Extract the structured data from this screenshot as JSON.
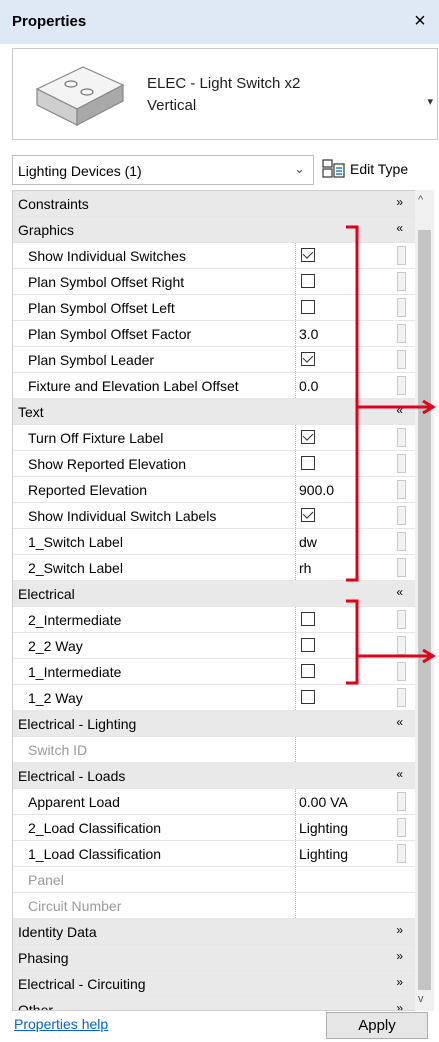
{
  "window": {
    "title": "Properties",
    "close_glyph": "×"
  },
  "type_selector": {
    "line1": "ELEC - Light Switch x2",
    "line2": "Vertical",
    "dropdown_glyph": "▾"
  },
  "instance_filter": {
    "value": "Lighting Devices (1)",
    "chevron": "⌄"
  },
  "edit_type": {
    "label": "Edit Type",
    "icon": "edit-type-icon"
  },
  "rows": [
    {
      "kind": "cat",
      "label": "Constraints",
      "toggle": "expand"
    },
    {
      "kind": "cat",
      "label": "Graphics",
      "toggle": "collapse"
    },
    {
      "kind": "prop",
      "label": "Show Individual Switches",
      "type": "check",
      "checked": true
    },
    {
      "kind": "prop",
      "label": "Plan Symbol Offset Right",
      "type": "check",
      "checked": false
    },
    {
      "kind": "prop",
      "label": "Plan Symbol Offset Left",
      "type": "check",
      "checked": false
    },
    {
      "kind": "prop",
      "label": "Plan Symbol Offset Factor",
      "type": "text",
      "value": "3.0"
    },
    {
      "kind": "prop",
      "label": "Plan Symbol Leader",
      "type": "check",
      "checked": true
    },
    {
      "kind": "prop",
      "label": "Fixture and Elevation Label Offset",
      "type": "text",
      "value": "0.0"
    },
    {
      "kind": "cat",
      "label": "Text",
      "toggle": "collapse"
    },
    {
      "kind": "prop",
      "label": "Turn Off Fixture Label",
      "type": "check",
      "checked": true
    },
    {
      "kind": "prop",
      "label": "Show Reported Elevation",
      "type": "check",
      "checked": false
    },
    {
      "kind": "prop",
      "label": "Reported Elevation",
      "type": "text",
      "value": "900.0"
    },
    {
      "kind": "prop",
      "label": "Show Individual Switch Labels",
      "type": "check",
      "checked": true
    },
    {
      "kind": "prop",
      "label": "1_Switch Label",
      "type": "text",
      "value": "dw"
    },
    {
      "kind": "prop",
      "label": "2_Switch Label",
      "type": "text",
      "value": "rh"
    },
    {
      "kind": "cat",
      "label": "Electrical",
      "toggle": "collapse"
    },
    {
      "kind": "prop",
      "label": "2_Intermediate",
      "type": "check",
      "checked": false
    },
    {
      "kind": "prop",
      "label": "2_2 Way",
      "type": "check",
      "checked": false
    },
    {
      "kind": "prop",
      "label": "1_Intermediate",
      "type": "check",
      "checked": false
    },
    {
      "kind": "prop",
      "label": "1_2 Way",
      "type": "check",
      "checked": false
    },
    {
      "kind": "cat",
      "label": "Electrical - Lighting",
      "toggle": "collapse"
    },
    {
      "kind": "prop",
      "label": "Switch ID",
      "type": "disabled",
      "value": ""
    },
    {
      "kind": "cat",
      "label": "Electrical - Loads",
      "toggle": "collapse"
    },
    {
      "kind": "prop",
      "label": "Apparent Load",
      "type": "text",
      "value": "0.00 VA"
    },
    {
      "kind": "prop",
      "label": "2_Load Classification",
      "type": "text",
      "value": "Lighting"
    },
    {
      "kind": "prop",
      "label": "1_Load Classification",
      "type": "text",
      "value": "Lighting"
    },
    {
      "kind": "prop",
      "label": "Panel",
      "type": "disabled",
      "value": ""
    },
    {
      "kind": "prop",
      "label": "Circuit Number",
      "type": "disabled",
      "value": ""
    },
    {
      "kind": "cat",
      "label": "Identity Data",
      "toggle": "expand"
    },
    {
      "kind": "cat",
      "label": "Phasing",
      "toggle": "expand"
    },
    {
      "kind": "cat",
      "label": "Electrical - Circuiting",
      "toggle": "expand"
    },
    {
      "kind": "cat",
      "label": "Other",
      "toggle": "expand"
    }
  ],
  "glyphs": {
    "expand": "»",
    "collapse": "«",
    "scroll_up": "^",
    "scroll_down": "v"
  },
  "footer": {
    "help_link": "Properties help",
    "apply_label": "Apply"
  },
  "colors": {
    "annotation": "#e0001a",
    "title_bg": "#dfe9f5",
    "category_bg": "#e9e9e9",
    "link": "#0066cc"
  }
}
